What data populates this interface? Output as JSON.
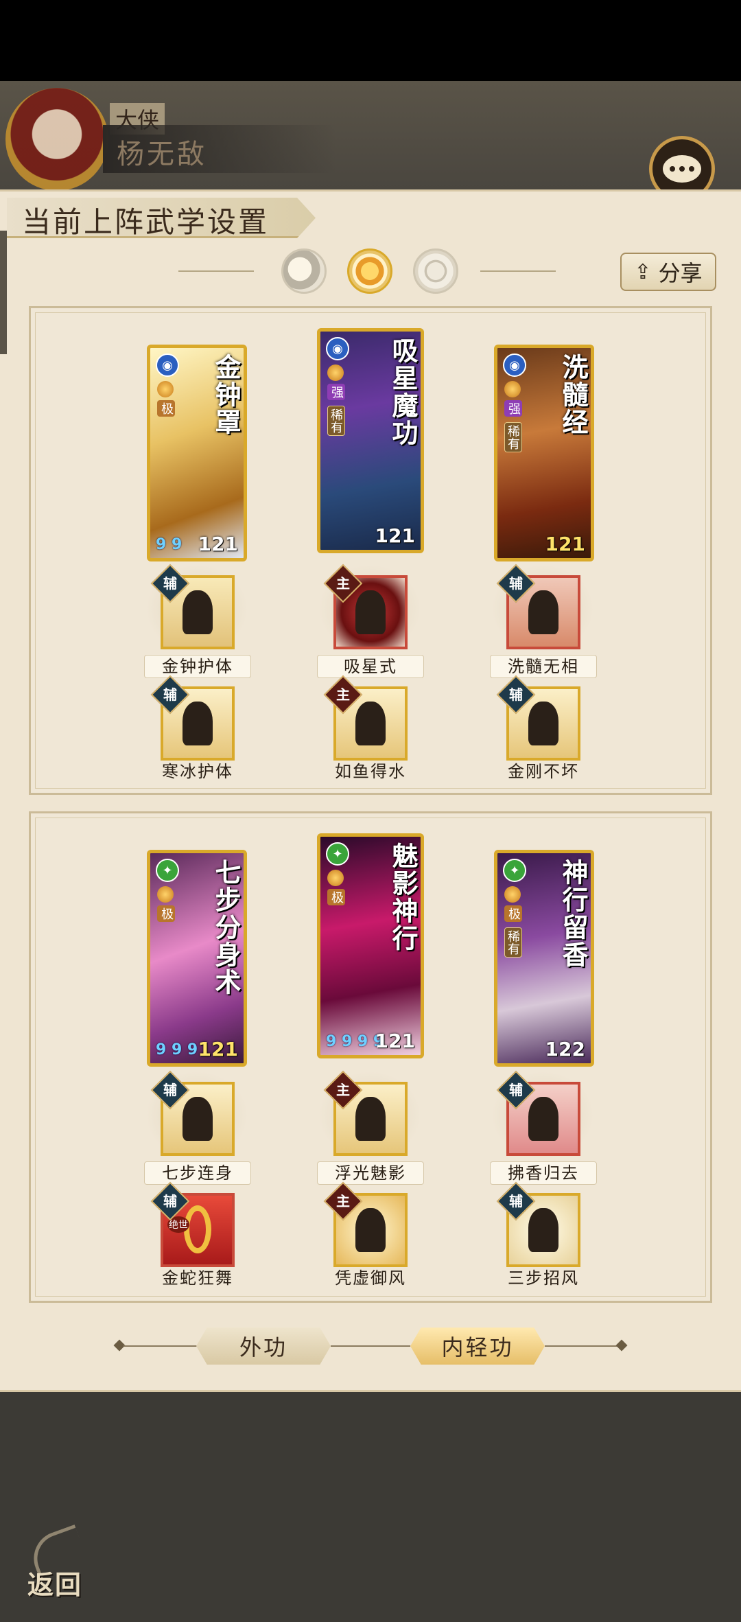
{
  "header": {
    "rank": "大侠",
    "player_name": "杨无敌"
  },
  "panel": {
    "title": "当前上阵武学设置",
    "share_label": "分享",
    "mode_icons": [
      "moon-icon",
      "sun-icon",
      "ring-icon"
    ],
    "selected_mode": 1
  },
  "group1": {
    "cards": [
      {
        "name": "金钟罩",
        "level": "121",
        "element_icon": "water-icon",
        "tags": [
          "极"
        ],
        "gems": "9 9"
      },
      {
        "name": "吸星魔功",
        "level": "121",
        "element_icon": "water-icon",
        "tags": [
          "强",
          "稀有"
        ],
        "gems": ""
      },
      {
        "name": "洗髓经",
        "level": "121",
        "element_icon": "water-icon",
        "tags": [
          "强",
          "稀有"
        ],
        "gems": ""
      }
    ],
    "skills_row1": [
      {
        "badge": "辅",
        "label": "金钟护体"
      },
      {
        "badge": "主",
        "label": "吸星式"
      },
      {
        "badge": "辅",
        "label": "洗髓无相"
      }
    ],
    "skills_row2": [
      {
        "badge": "辅",
        "label": "寒冰护体"
      },
      {
        "badge": "主",
        "label": "如鱼得水"
      },
      {
        "badge": "辅",
        "label": "金刚不坏"
      }
    ]
  },
  "group2": {
    "cards": [
      {
        "name": "七步分身术",
        "level": "121",
        "element_icon": "wind-icon",
        "tags": [
          "极"
        ],
        "gems": "9 9 9"
      },
      {
        "name": "魅影神行",
        "level": "121",
        "element_icon": "wind-icon",
        "tags": [
          "极"
        ],
        "gems": "9 9 9 9"
      },
      {
        "name": "神行留香",
        "level": "122",
        "element_icon": "wind-icon",
        "tags": [
          "极",
          "稀有"
        ],
        "gems": ""
      }
    ],
    "skills_row1": [
      {
        "badge": "辅",
        "label": "七步连身"
      },
      {
        "badge": "主",
        "label": "浮光魅影"
      },
      {
        "badge": "辅",
        "label": "拂香归去"
      }
    ],
    "skills_row2": [
      {
        "badge": "辅",
        "label": "金蛇狂舞",
        "sub_tag": "绝世"
      },
      {
        "badge": "主",
        "label": "凭虚御风"
      },
      {
        "badge": "辅",
        "label": "三步招风"
      }
    ]
  },
  "tabs": {
    "outer": "外功",
    "inner": "内轻功",
    "active": "inner"
  },
  "back_label": "返回"
}
